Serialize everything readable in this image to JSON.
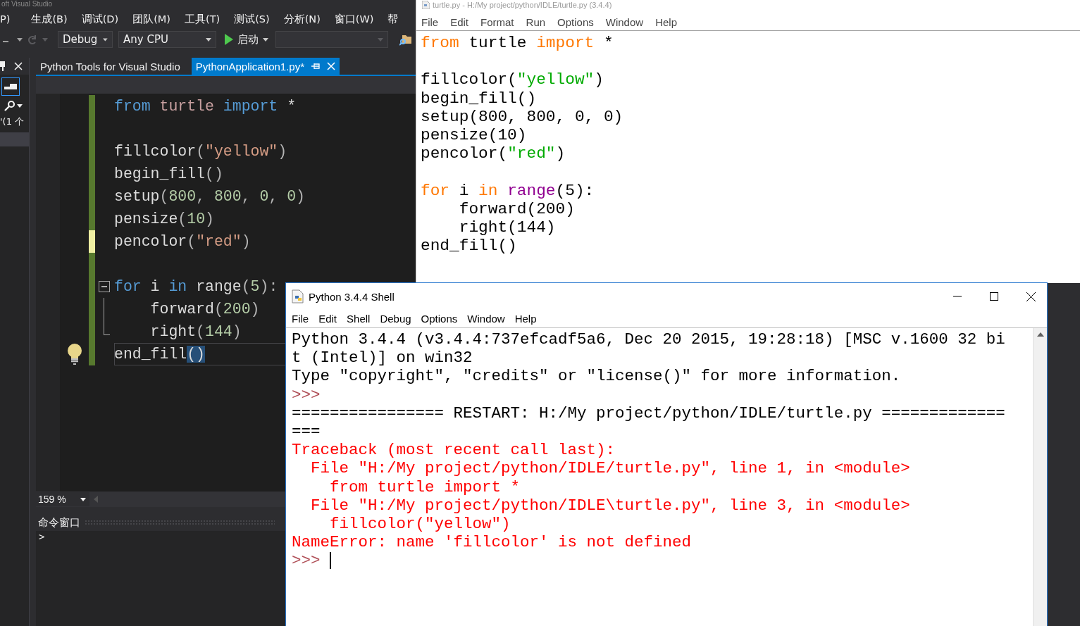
{
  "vs": {
    "title": "oft Visual Studio",
    "menu": [
      "P)",
      "生成(B)",
      "调试(D)",
      "团队(M)",
      "工具(T)",
      "测试(S)",
      "分析(N)",
      "窗口(W)",
      "帮"
    ],
    "toolbar": {
      "configuration": "Debug",
      "platform": "Any CPU",
      "start": "启动"
    },
    "side_panel": {
      "text": "'(1 个"
    },
    "tabs": [
      {
        "label": "Python Tools for Visual Studio",
        "selected": false
      },
      {
        "label": "PythonApplication1.py*",
        "selected": true
      }
    ],
    "editor": {
      "lines": [
        {
          "kind": "code",
          "saved": true,
          "current": false,
          "lightbulb": false,
          "tokens": [
            {
              "text": "from",
              "kind": "kw"
            },
            {
              "text": " turtle ",
              "kind": "module"
            },
            {
              "text": "import",
              "kind": "kw"
            },
            {
              "text": " *",
              "kind": "text"
            }
          ]
        },
        {
          "kind": "blank",
          "saved": true,
          "current": false,
          "lightbulb": false
        },
        {
          "kind": "code",
          "saved": true,
          "current": false,
          "lightbulb": false,
          "tokens": [
            {
              "text": "fillcolor",
              "kind": "text"
            },
            {
              "text": "(",
              "kind": "punct"
            },
            {
              "text": "\"yellow\"",
              "kind": "str"
            },
            {
              "text": ")",
              "kind": "punct"
            }
          ]
        },
        {
          "kind": "code",
          "saved": true,
          "current": false,
          "lightbulb": false,
          "tokens": [
            {
              "text": "begin_fill",
              "kind": "text"
            },
            {
              "text": "()",
              "kind": "punct"
            }
          ]
        },
        {
          "kind": "code",
          "saved": true,
          "current": false,
          "lightbulb": false,
          "tokens": [
            {
              "text": "setup",
              "kind": "text"
            },
            {
              "text": "(",
              "kind": "punct"
            },
            {
              "text": "800",
              "kind": "num"
            },
            {
              "text": ", ",
              "kind": "punct"
            },
            {
              "text": "800",
              "kind": "num"
            },
            {
              "text": ", ",
              "kind": "punct"
            },
            {
              "text": "0",
              "kind": "num"
            },
            {
              "text": ", ",
              "kind": "punct"
            },
            {
              "text": "0",
              "kind": "num"
            },
            {
              "text": ")",
              "kind": "punct"
            }
          ]
        },
        {
          "kind": "code",
          "saved": true,
          "current": false,
          "lightbulb": false,
          "tokens": [
            {
              "text": "pensize",
              "kind": "text"
            },
            {
              "text": "(",
              "kind": "punct"
            },
            {
              "text": "10",
              "kind": "num"
            },
            {
              "text": ")",
              "kind": "punct"
            }
          ]
        },
        {
          "kind": "code",
          "saved": false,
          "current": false,
          "lightbulb": false,
          "tokens": [
            {
              "text": "pencolor",
              "kind": "text"
            },
            {
              "text": "(",
              "kind": "punct"
            },
            {
              "text": "\"red\"",
              "kind": "str"
            },
            {
              "text": ")",
              "kind": "punct"
            }
          ]
        },
        {
          "kind": "blank",
          "saved": true,
          "current": false,
          "lightbulb": false
        },
        {
          "kind": "code",
          "saved": true,
          "current": false,
          "lightbulb": false,
          "tokens": [
            {
              "text": "for",
              "kind": "kw"
            },
            {
              "text": " i ",
              "kind": "text"
            },
            {
              "text": "in",
              "kind": "kw"
            },
            {
              "text": " range",
              "kind": "text"
            },
            {
              "text": "(",
              "kind": "punct"
            },
            {
              "text": "5",
              "kind": "num"
            },
            {
              "text": "):",
              "kind": "punct"
            }
          ],
          "children": [
            {
              "kind": "code",
              "saved": true,
              "current": false,
              "lightbulb": false,
              "tokens": [
                {
                  "text": "forward",
                  "kind": "text"
                },
                {
                  "text": "(",
                  "kind": "punct"
                },
                {
                  "text": "200",
                  "kind": "num"
                },
                {
                  "text": ")",
                  "kind": "punct"
                }
              ]
            },
            {
              "kind": "code",
              "saved": true,
              "current": false,
              "lightbulb": false,
              "tokens": [
                {
                  "text": "right",
                  "kind": "text"
                },
                {
                  "text": "(",
                  "kind": "punct"
                },
                {
                  "text": "144",
                  "kind": "num"
                },
                {
                  "text": ")",
                  "kind": "punct"
                }
              ]
            }
          ]
        },
        {
          "kind": "code",
          "saved": true,
          "current": true,
          "lightbulb": true,
          "tokens": [
            {
              "text": "end_fill",
              "kind": "text"
            },
            {
              "text": "()",
              "kind": "brace"
            }
          ]
        }
      ],
      "zoom": "159 %"
    },
    "command_window": {
      "title": "命令窗口",
      "prompt": ">"
    }
  },
  "idle_editor": {
    "title": "turtle.py - H:/My project/python/IDLE/turtle.py (3.4.4)",
    "menu": [
      "File",
      "Edit",
      "Format",
      "Run",
      "Options",
      "Window",
      "Help"
    ],
    "lines": [
      {
        "kind": "code",
        "tokens": [
          {
            "text": "from",
            "kind": "kw"
          },
          {
            "text": " turtle ",
            "kind": "text"
          },
          {
            "text": "import",
            "kind": "kw"
          },
          {
            "text": " *",
            "kind": "text"
          }
        ]
      },
      {
        "kind": "blank"
      },
      {
        "kind": "code",
        "tokens": [
          {
            "text": "fillcolor(",
            "kind": "text"
          },
          {
            "text": "\"yellow\"",
            "kind": "str"
          },
          {
            "text": ")",
            "kind": "text"
          }
        ]
      },
      {
        "kind": "code",
        "tokens": [
          {
            "text": "begin_fill()",
            "kind": "text"
          }
        ]
      },
      {
        "kind": "code",
        "tokens": [
          {
            "text": "setup(800, 800, 0, 0)",
            "kind": "text"
          }
        ]
      },
      {
        "kind": "code",
        "tokens": [
          {
            "text": "pensize(10)",
            "kind": "text"
          }
        ]
      },
      {
        "kind": "code",
        "tokens": [
          {
            "text": "pencolor(",
            "kind": "text"
          },
          {
            "text": "\"red\"",
            "kind": "str"
          },
          {
            "text": ")",
            "kind": "text"
          }
        ]
      },
      {
        "kind": "blank"
      },
      {
        "kind": "code",
        "tokens": [
          {
            "text": "for",
            "kind": "kw"
          },
          {
            "text": " i ",
            "kind": "text"
          },
          {
            "text": "in",
            "kind": "kw"
          },
          {
            "text": " range",
            "kind": "builtin"
          },
          {
            "text": "(5):",
            "kind": "text"
          }
        ],
        "children": [
          {
            "kind": "code",
            "tokens": [
              {
                "text": "forward(200)",
                "kind": "text"
              }
            ]
          },
          {
            "kind": "code",
            "tokens": [
              {
                "text": "right(144)",
                "kind": "text"
              }
            ]
          }
        ]
      },
      {
        "kind": "code",
        "tokens": [
          {
            "text": "end_fill()",
            "kind": "text"
          }
        ]
      }
    ]
  },
  "shell": {
    "title": "Python 3.4.4 Shell",
    "menu": [
      "File",
      "Edit",
      "Shell",
      "Debug",
      "Options",
      "Window",
      "Help"
    ],
    "lines": [
      {
        "kind": "output",
        "text": "Python 3.4.4 (v3.4.4:737efcadf5a6, Dec 20 2015, 19:28:18) [MSC v.1600 32 bi"
      },
      {
        "kind": "output",
        "text": "t (Intel)] on win32"
      },
      {
        "kind": "output",
        "text": "Type \"copyright\", \"credits\" or \"license()\" for more information."
      },
      {
        "kind": "prompt",
        "text": ">>>"
      },
      {
        "kind": "output",
        "text": "================ RESTART: H:/My project/python/IDLE/turtle.py ============="
      },
      {
        "kind": "output",
        "text": "==="
      },
      {
        "kind": "error",
        "text": "Traceback (most recent call last):"
      },
      {
        "kind": "error",
        "text": "  File \"H:/My project/python/IDLE/turtle.py\", line 1, in <module>"
      },
      {
        "kind": "error",
        "text": "    from turtle import *"
      },
      {
        "kind": "error",
        "text": "  File \"H:/My project/python/IDLE\\turtle.py\", line 3, in <module>"
      },
      {
        "kind": "error",
        "text": "    fillcolor(\"yellow\")"
      },
      {
        "kind": "error",
        "text": "NameError: name 'fillcolor' is not defined"
      },
      {
        "kind": "prompt",
        "text": ">>>",
        "cursor": true
      }
    ]
  }
}
